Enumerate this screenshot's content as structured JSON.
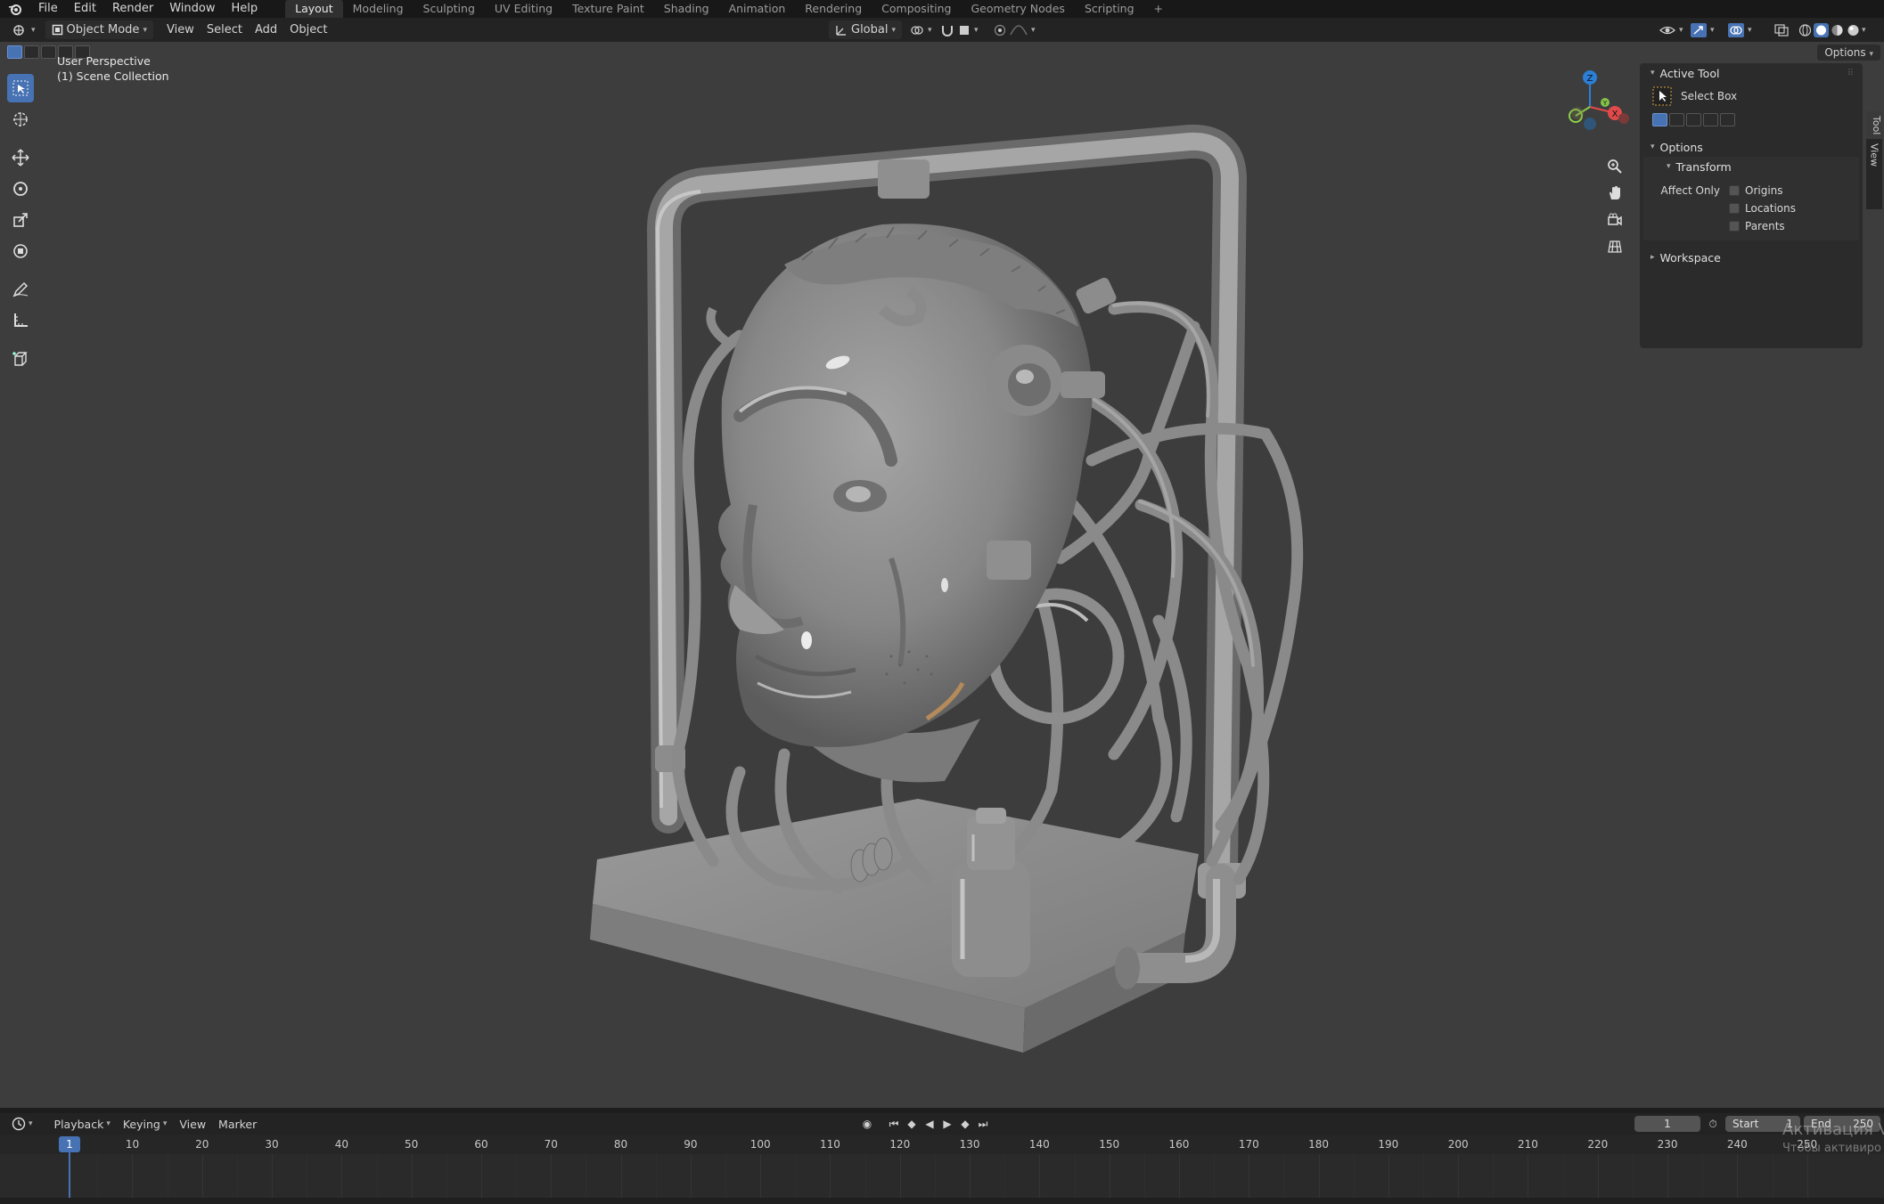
{
  "topbar": {
    "menus": [
      "File",
      "Edit",
      "Render",
      "Window",
      "Help"
    ],
    "workspaces": [
      "Layout",
      "Modeling",
      "Sculpting",
      "UV Editing",
      "Texture Paint",
      "Shading",
      "Animation",
      "Rendering",
      "Compositing",
      "Geometry Nodes",
      "Scripting"
    ],
    "active_workspace": "Layout",
    "add_tab": "+"
  },
  "header": {
    "mode": "Object Mode",
    "menus": [
      "View",
      "Select",
      "Add",
      "Object"
    ],
    "orientation": "Global",
    "options": "Options"
  },
  "viewport": {
    "perspective": "User Perspective",
    "collection": "(1) Scene Collection",
    "gizmo": {
      "z": "Z",
      "y": "Y",
      "x": "X"
    }
  },
  "npanel": {
    "active_tool_title": "Active Tool",
    "active_tool_name": "Select Box",
    "options_title": "Options",
    "transform_title": "Transform",
    "affect_only_label": "Affect Only",
    "checks": [
      "Origins",
      "Locations",
      "Parents"
    ],
    "workspace_title": "Workspace",
    "tabs": [
      "Tool",
      "View"
    ]
  },
  "watermark": {
    "line1": "Активация V",
    "line2": "Чтобы активиро"
  },
  "timeline": {
    "menus": [
      "Playback",
      "Keying",
      "View",
      "Marker"
    ],
    "current_frame": "1",
    "start_label": "Start",
    "start_value": "1",
    "end_label": "End",
    "end_value": "250",
    "ruler_marker": "1",
    "ticks": [
      {
        "label": "10",
        "frame": 10
      },
      {
        "label": "20",
        "frame": 20
      },
      {
        "label": "30",
        "frame": 30
      },
      {
        "label": "40",
        "frame": 40
      },
      {
        "label": "50",
        "frame": 50
      },
      {
        "label": "60",
        "frame": 60
      },
      {
        "label": "70",
        "frame": 70
      },
      {
        "label": "80",
        "frame": 80
      },
      {
        "label": "90",
        "frame": 90
      },
      {
        "label": "100",
        "frame": 100
      },
      {
        "label": "110",
        "frame": 110
      },
      {
        "label": "120",
        "frame": 120
      },
      {
        "label": "130",
        "frame": 130
      },
      {
        "label": "140",
        "frame": 140
      },
      {
        "label": "150",
        "frame": 150
      },
      {
        "label": "160",
        "frame": 160
      },
      {
        "label": "170",
        "frame": 170
      },
      {
        "label": "180",
        "frame": 180
      },
      {
        "label": "190",
        "frame": 190
      },
      {
        "label": "200",
        "frame": 200
      },
      {
        "label": "210",
        "frame": 210
      },
      {
        "label": "220",
        "frame": 220
      },
      {
        "label": "230",
        "frame": 230
      },
      {
        "label": "240",
        "frame": 240
      },
      {
        "label": "250",
        "frame": 250
      }
    ]
  }
}
